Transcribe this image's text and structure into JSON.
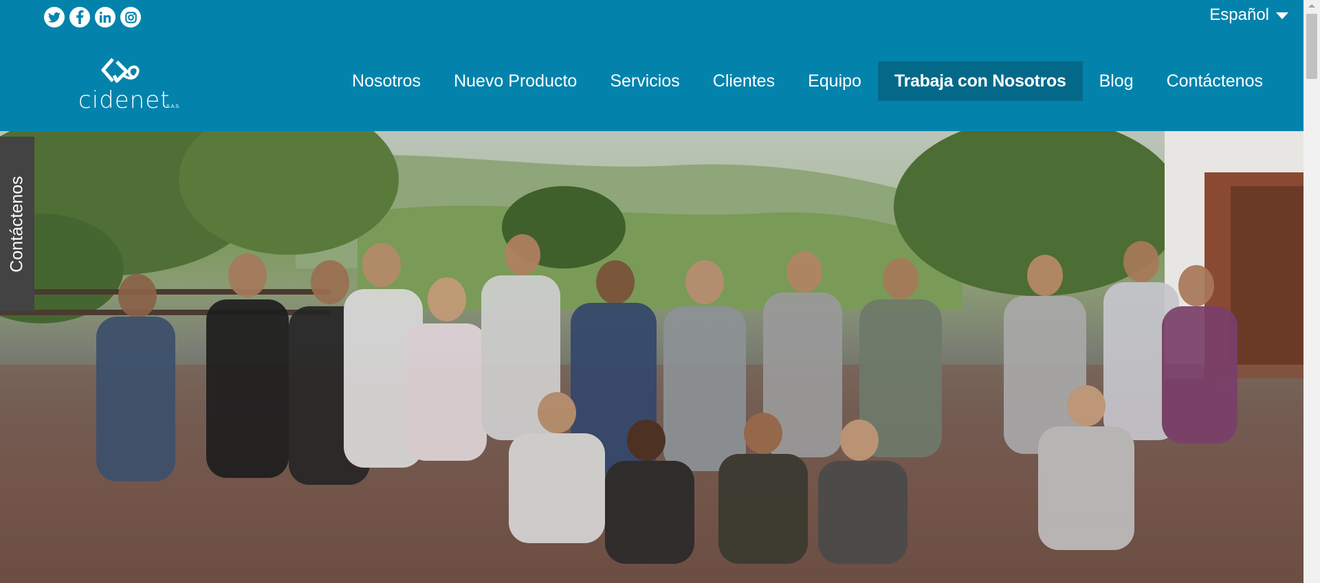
{
  "header": {
    "social": [
      {
        "name": "twitter-icon"
      },
      {
        "name": "facebook-icon"
      },
      {
        "name": "linkedin-icon"
      },
      {
        "name": "instagram-icon"
      }
    ],
    "language": "Español",
    "logo": {
      "text": "cidenet",
      "suffix": "S.A.S."
    }
  },
  "nav": {
    "items": [
      {
        "label": "Nosotros",
        "active": false
      },
      {
        "label": "Nuevo Producto",
        "active": false
      },
      {
        "label": "Servicios",
        "active": false
      },
      {
        "label": "Clientes",
        "active": false
      },
      {
        "label": "Equipo",
        "active": false
      },
      {
        "label": "Trabaja con Nosotros",
        "active": true
      },
      {
        "label": "Blog",
        "active": false
      },
      {
        "label": "Contáctenos",
        "active": false
      }
    ]
  },
  "side_tab": {
    "label": "Contáctenos"
  },
  "hero": {
    "image": "team-group-photo"
  },
  "colors": {
    "header_bg": "#0383ac",
    "nav_active_bg": "#046989",
    "side_tab_bg": "#434343"
  }
}
